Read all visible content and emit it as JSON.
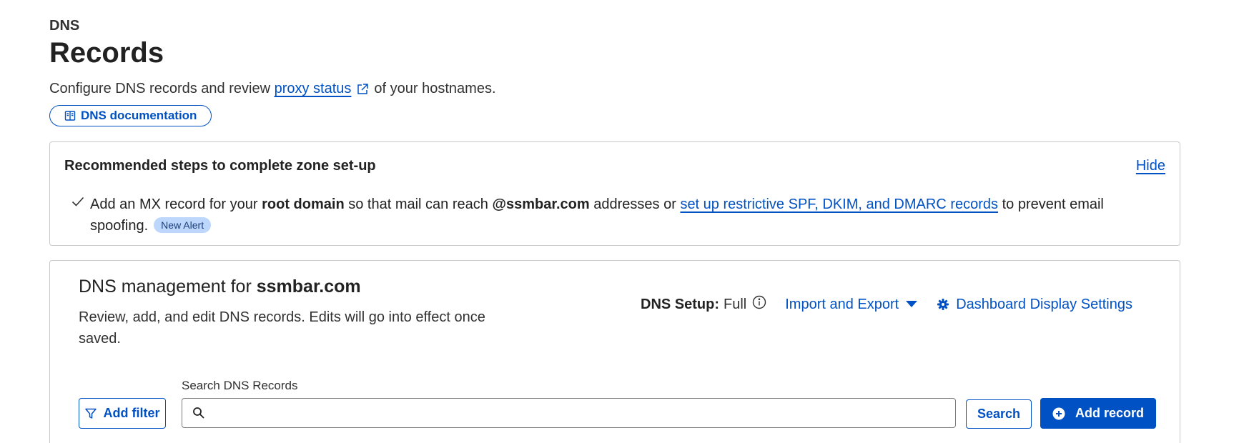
{
  "header": {
    "breadcrumb": "DNS",
    "title": "Records",
    "description_before": "Configure DNS records and review",
    "description_link": "proxy status",
    "description_after": "of your hostnames.",
    "doc_button": "DNS documentation"
  },
  "recommendations": {
    "title": "Recommended steps to complete zone set-up",
    "hide_label": "Hide",
    "item": {
      "part1": "Add an MX record for your",
      "bold1": "root domain",
      "part2": "so that mail can reach",
      "bold2": "@ssmbar.com",
      "part3": "addresses or",
      "link": "set up restrictive SPF, DKIM, and DMARC records",
      "part4": "to prevent email spoofing.",
      "badge": "New Alert"
    }
  },
  "management": {
    "title_prefix": "DNS management for",
    "domain": "ssmbar.com",
    "description": "Review, add, and edit DNS records. Edits will go into effect once saved.",
    "setup_label": "DNS Setup:",
    "setup_value": "Full",
    "import_export": "Import and Export",
    "display_settings": "Dashboard Display Settings",
    "search_label": "Search DNS Records",
    "search_value": "",
    "search_placeholder": "",
    "add_filter": "Add filter",
    "search_button": "Search",
    "add_record": "Add record"
  },
  "colors": {
    "accent": "#0051c3",
    "badge_bg": "#bcd7fb",
    "border": "#c9c9c9"
  },
  "icons": {
    "external_link": "external-link-icon",
    "documentation": "book-icon",
    "check": "check-icon",
    "info": "info-icon",
    "caret": "caret-down-icon",
    "settings": "gear-icon",
    "filter": "filter-icon",
    "search": "search-icon",
    "add": "plus-circle-icon"
  }
}
